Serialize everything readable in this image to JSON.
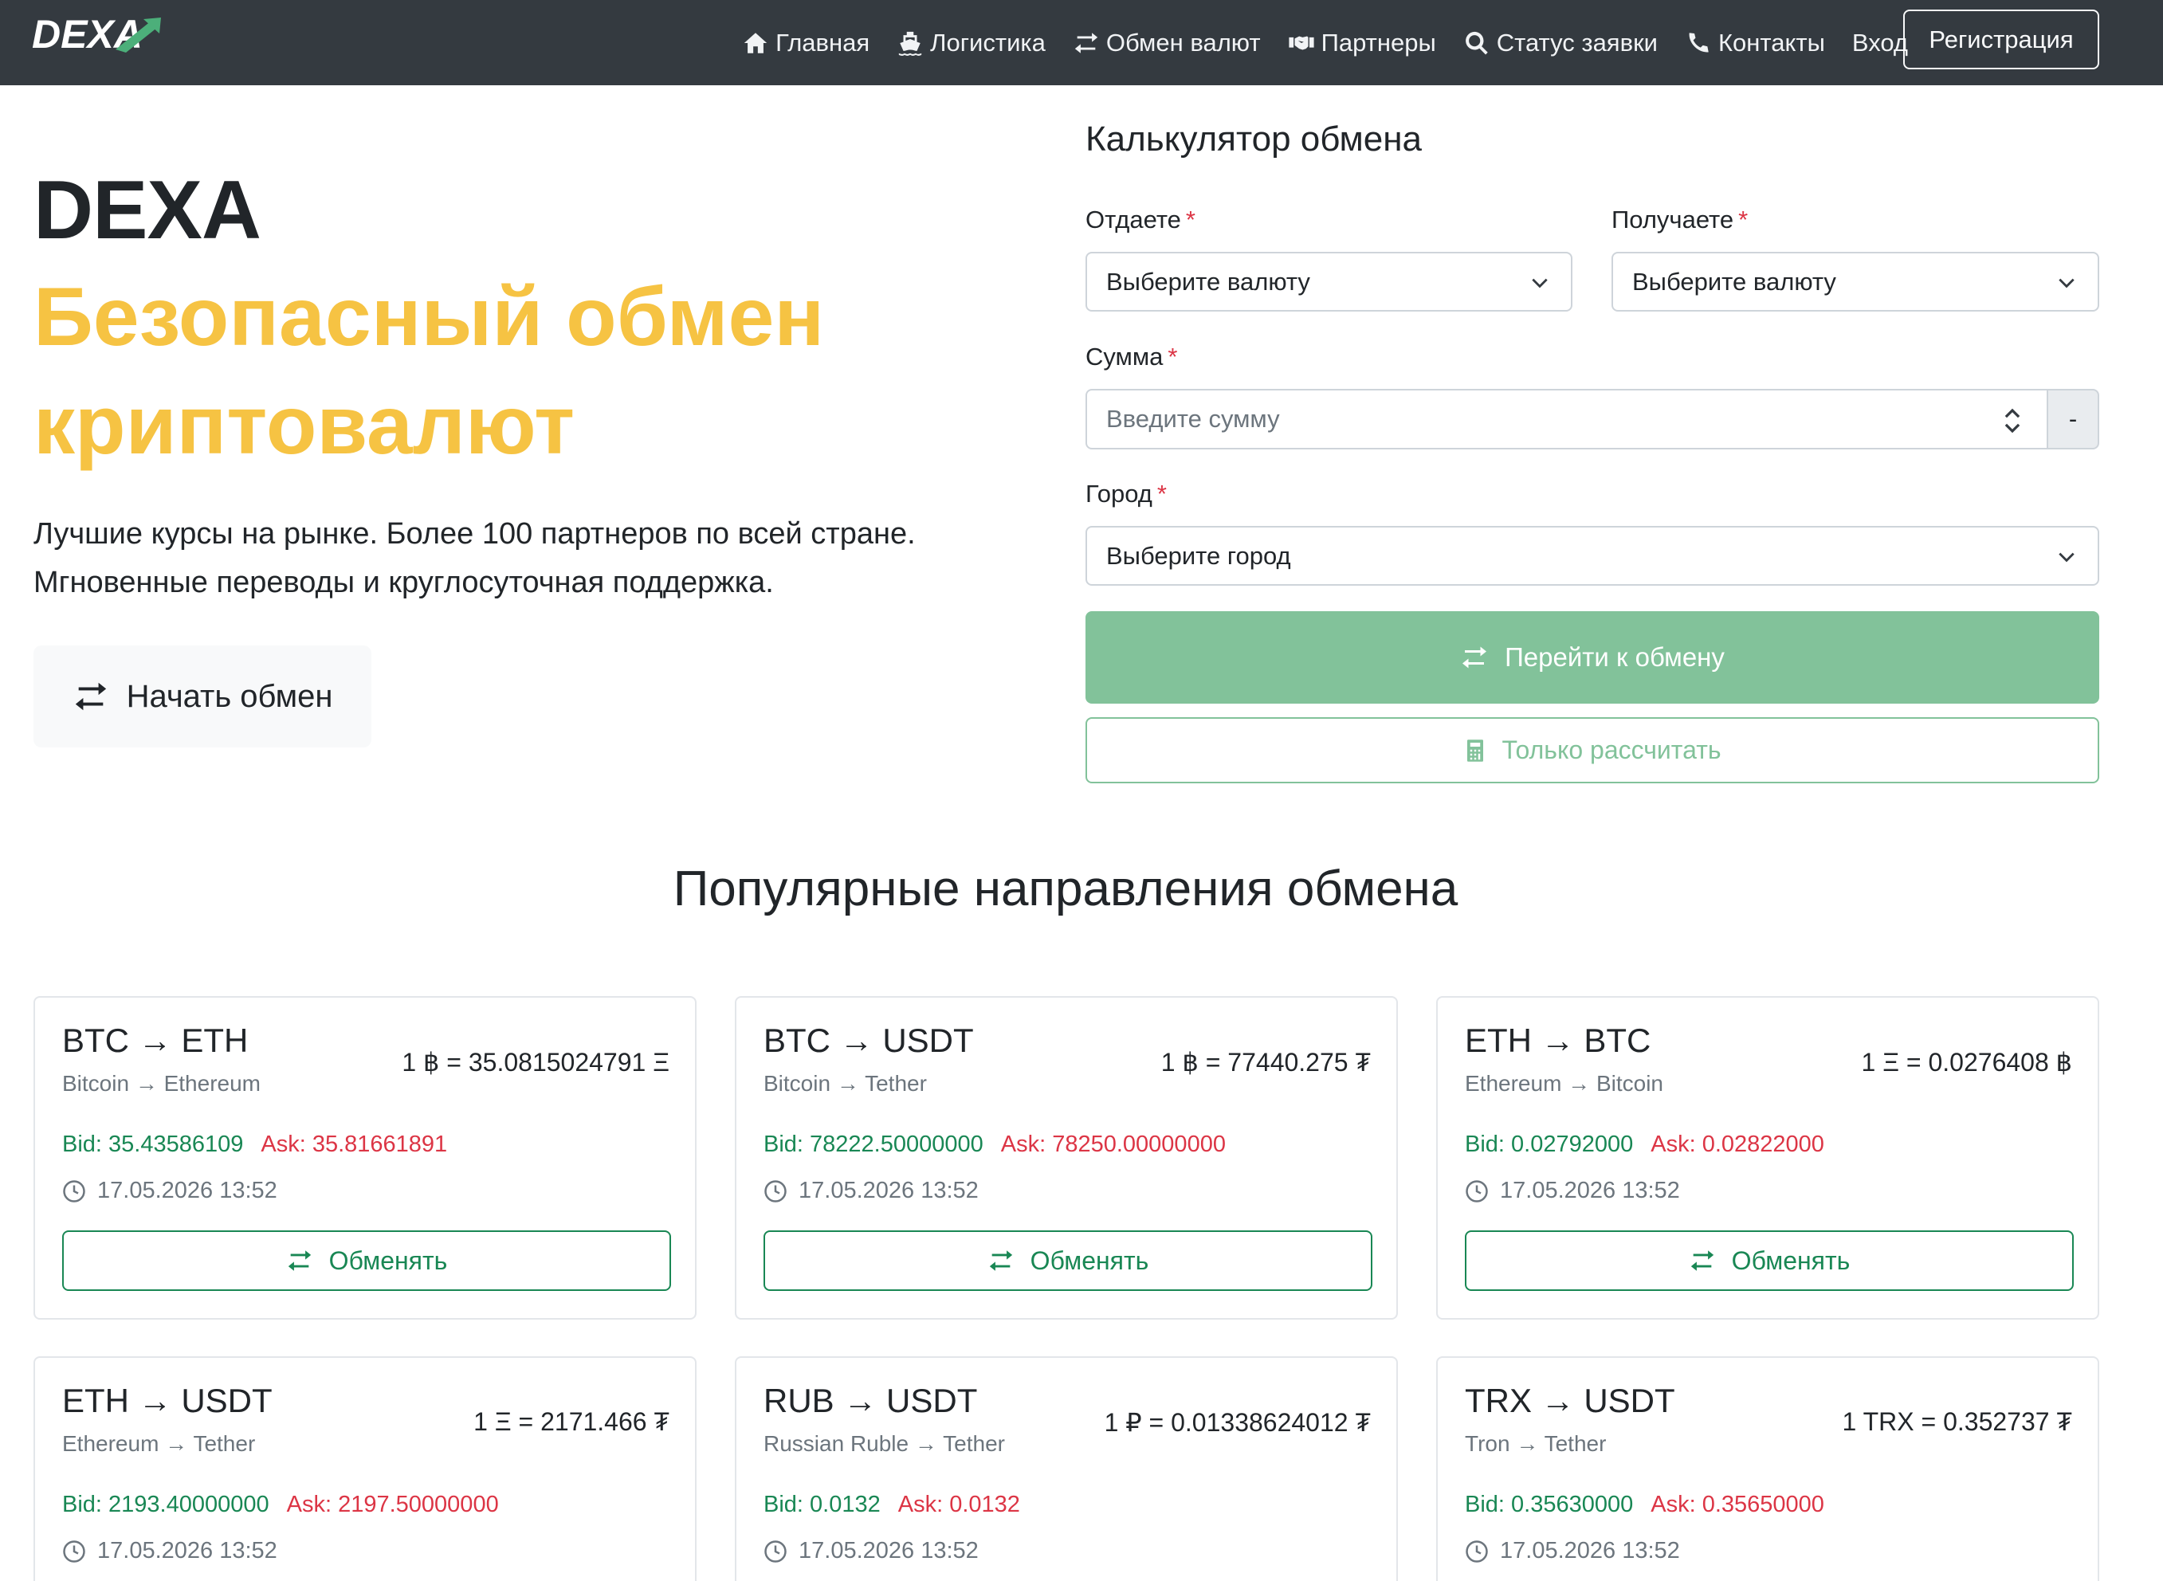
{
  "navbar": {
    "logo_text": "DEXA",
    "items": [
      {
        "label": "Главная",
        "icon": "home-icon"
      },
      {
        "label": "Логистика",
        "icon": "ship-icon"
      },
      {
        "label": "Обмен валют",
        "icon": "exchange-icon"
      },
      {
        "label": "Партнеры",
        "icon": "handshake-icon"
      },
      {
        "label": "Статус заявки",
        "icon": "search-icon"
      },
      {
        "label": "Контакты",
        "icon": "phone-icon"
      },
      {
        "label": "Вход",
        "icon": ""
      }
    ],
    "register_label": "Регистрация"
  },
  "hero": {
    "brand": "DEXA",
    "title": "Безопасный обмен криптовалют",
    "text": "Лучшие курсы на рынке. Более 100 партнеров по всей стране. Мгновенные переводы и круглосуточная поддержка.",
    "start_button": "Начать обмен"
  },
  "calculator": {
    "title": "Калькулятор обмена",
    "give_label": "Отдаете",
    "get_label": "Получаете",
    "required_mark": "*",
    "give_value": "Выберите валюту",
    "get_value": "Выберите валюту",
    "amount_label": "Сумма",
    "amount_placeholder": "Введите сумму",
    "amount_addon": "-",
    "city_label": "Город",
    "city_value": "Выберите город",
    "go_button": "Перейти к обмену",
    "calc_button": "Только рассчитать"
  },
  "popular": {
    "title": "Популярные направления обмена",
    "cards": [
      {
        "pair": "BTC → ETH",
        "names": "Bitcoin → Ethereum",
        "rate": "1 ฿ = 35.0815024791 Ξ",
        "bid": "Bid: 35.43586109",
        "ask": "Ask: 35.81661891",
        "time": "17.05.2026 13:52",
        "button": "Обменять"
      },
      {
        "pair": "BTC → USDT",
        "names": "Bitcoin → Tether",
        "rate": "1 ฿ = 77440.275 ₮",
        "bid": "Bid: 78222.50000000",
        "ask": "Ask: 78250.00000000",
        "time": "17.05.2026 13:52",
        "button": "Обменять"
      },
      {
        "pair": "ETH → BTC",
        "names": "Ethereum → Bitcoin",
        "rate": "1 Ξ = 0.0276408 ฿",
        "bid": "Bid: 0.02792000",
        "ask": "Ask: 0.02822000",
        "time": "17.05.2026 13:52",
        "button": "Обменять"
      },
      {
        "pair": "ETH → USDT",
        "names": "Ethereum → Tether",
        "rate": "1 Ξ = 2171.466 ₮",
        "bid": "Bid: 2193.40000000",
        "ask": "Ask: 2197.50000000",
        "time": "17.05.2026 13:52",
        "button": "Обменять"
      },
      {
        "pair": "RUB → USDT",
        "names": "Russian Ruble → Tether",
        "rate": "1 ₽ = 0.01338624012 ₮",
        "bid": "Bid: 0.0132",
        "ask": "Ask: 0.0132",
        "time": "17.05.2026 13:52",
        "button": "Обменять"
      },
      {
        "pair": "TRX → USDT",
        "names": "Tron → Tether",
        "rate": "1 TRX = 0.352737 ₮",
        "bid": "Bid: 0.35630000",
        "ask": "Ask: 0.35650000",
        "time": "17.05.2026 13:52",
        "button": "Обменять"
      }
    ]
  },
  "colors": {
    "navbar_bg": "#343a40",
    "accent_yellow": "#f6c343",
    "success_green": "#198754",
    "muted_green": "#82c29a",
    "danger_red": "#dc3545"
  }
}
